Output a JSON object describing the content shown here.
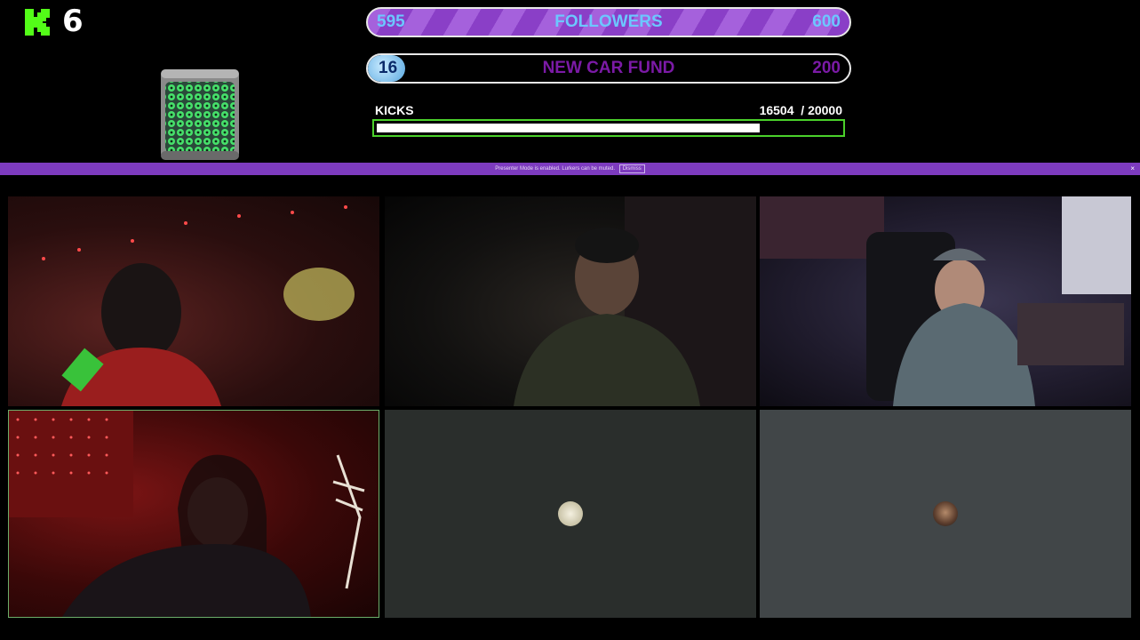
{
  "overlay": {
    "kick_count": "6",
    "followers_goal": {
      "start": "595",
      "label": "FOLLOWERS",
      "end": "600"
    },
    "car_goal": {
      "start": "16",
      "label": "NEW CAR FUND",
      "end": "200"
    },
    "kicks": {
      "label": "KICKS",
      "count_text": "16504  / 20000",
      "current": 16504,
      "target": 20000
    }
  },
  "banner": {
    "text": "Presenter Mode is enabled. Lurkers can be muted.",
    "button_label": "Dismiss",
    "close_glyph": "×"
  },
  "tiles": [
    {
      "id": "tile-1",
      "content": "camera"
    },
    {
      "id": "tile-2",
      "content": "camera"
    },
    {
      "id": "tile-3",
      "content": "camera"
    },
    {
      "id": "tile-4",
      "content": "camera",
      "active_speaker": true
    },
    {
      "id": "tile-5",
      "content": "avatar"
    },
    {
      "id": "tile-6",
      "content": "avatar"
    }
  ],
  "colors": {
    "accent": "#7d3bbf",
    "kick_green": "#53fc18",
    "bar_border": "#4ad02a"
  }
}
